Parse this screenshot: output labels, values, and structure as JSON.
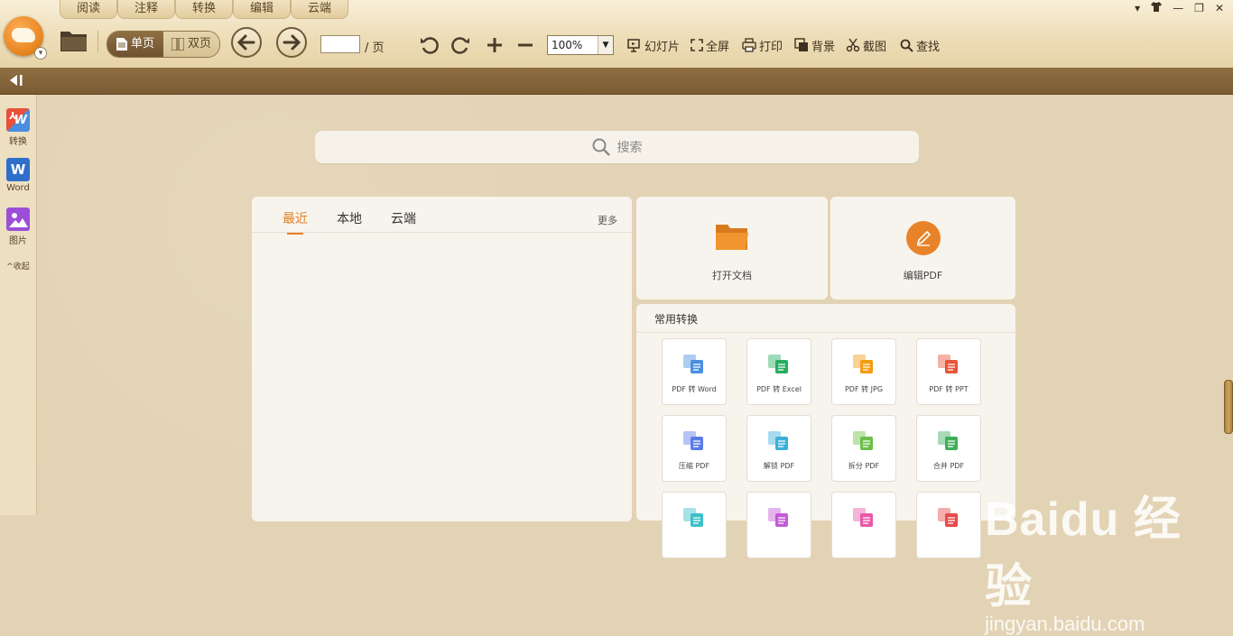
{
  "window": {
    "controls": [
      "▾",
      "👕",
      "—",
      "❐",
      "✕"
    ]
  },
  "tabs": [
    "阅读",
    "注释",
    "转换",
    "编辑",
    "云端"
  ],
  "toolbar": {
    "single_page": "单页",
    "double_page": "双页",
    "page_value": "",
    "page_suffix": "/ 页",
    "zoom": "100%",
    "tools": {
      "slideshow": "幻灯片",
      "fullscreen": "全屏",
      "print": "打印",
      "background": "背景",
      "screenshot": "截图",
      "find": "查找"
    }
  },
  "sidebar": {
    "items": [
      {
        "label": "转换",
        "icon": "pdf-to-word-icon"
      },
      {
        "label": "Word",
        "icon": "word-icon"
      },
      {
        "label": "图片",
        "icon": "image-icon"
      }
    ],
    "collapse": "收起"
  },
  "search": {
    "placeholder": "搜索"
  },
  "recent": {
    "tabs": [
      "最近",
      "本地",
      "云端"
    ],
    "more": "更多"
  },
  "quick": {
    "open": "打开文档",
    "edit": "编辑PDF"
  },
  "convert": {
    "title": "常用转换",
    "items": [
      {
        "label": "PDF 转 Word",
        "color": "#4a90e2"
      },
      {
        "label": "PDF 转 Excel",
        "color": "#27ae60"
      },
      {
        "label": "PDF 转 JPG",
        "color": "#f39c12"
      },
      {
        "label": "PDF 转 PPT",
        "color": "#e8553a"
      },
      {
        "label": "压缩 PDF",
        "color": "#5b7be8"
      },
      {
        "label": "解锁 PDF",
        "color": "#3bb0d8"
      },
      {
        "label": "拆分 PDF",
        "color": "#6cc04a"
      },
      {
        "label": "合并 PDF",
        "color": "#3fae5a"
      },
      {
        "label": "",
        "color": "#3cc0c8"
      },
      {
        "label": "",
        "color": "#c45ad8"
      },
      {
        "label": "",
        "color": "#e85aa8"
      },
      {
        "label": "",
        "color": "#e84a4a"
      }
    ]
  },
  "watermark": {
    "main": "Baidu 经验",
    "sub": "jingyan.baidu.com"
  }
}
